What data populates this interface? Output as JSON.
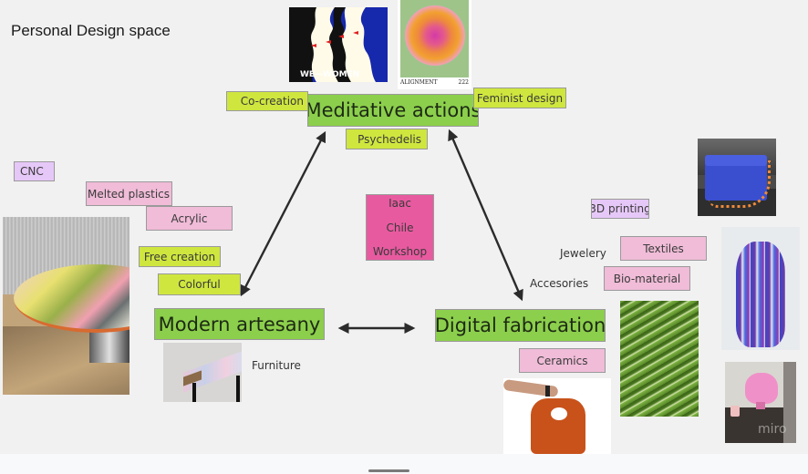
{
  "board": {
    "title": "Personal Design space",
    "watermark": "miro"
  },
  "main_nodes": {
    "meditative": "Meditative actions",
    "modern": "Modern artesany",
    "digital": "Digital fabrication"
  },
  "stickies": {
    "co_creation": "Co-creation",
    "feminist_design": "Feminist design",
    "psychedelis": "Psychedelis",
    "cnc": "CNC",
    "melted_plastics": "Melted plastics",
    "acrylic": "Acrylic",
    "free_creation": "Free creation",
    "colorful": "Colorful",
    "printing_3d": "3D printing",
    "textiles": "Textiles",
    "bio_material": "Bio-material",
    "ceramics": "Ceramics",
    "workshop_lines": [
      "Iaac",
      "Chile",
      "Workshop"
    ]
  },
  "labels": {
    "furniture": "Furniture",
    "jewelery": "Jewelery",
    "accesories": "Accesories"
  },
  "images": {
    "we_women": {
      "caption": "WE—WOMEN",
      "alt": "We Women poster"
    },
    "alignment": {
      "caption": "ALIGNMENT",
      "number": "222",
      "alt": "Alignment gradient poster"
    },
    "round_table": {
      "alt": "Melted plastic round table"
    },
    "side_table": {
      "alt": "Colorful table corner"
    },
    "blue_bag": {
      "alt": "3D printed blue bag with orange chain"
    },
    "vase": {
      "alt": "Striped 3D printed vase"
    },
    "green_textile": {
      "alt": "Green wavy textile"
    },
    "orange_bag": {
      "alt": "Orange bio-material bag"
    },
    "pink_lamp": {
      "alt": "Pink lamp"
    }
  },
  "colors": {
    "lime_sticky": "#cfe63f",
    "green_node": "#8ccf4c",
    "pink_sticky": "#f0bcd8",
    "lilac_sticky": "#e6c8f8",
    "magenta_sticky": "#e85aa0",
    "arrow": "#2b2b2b"
  }
}
